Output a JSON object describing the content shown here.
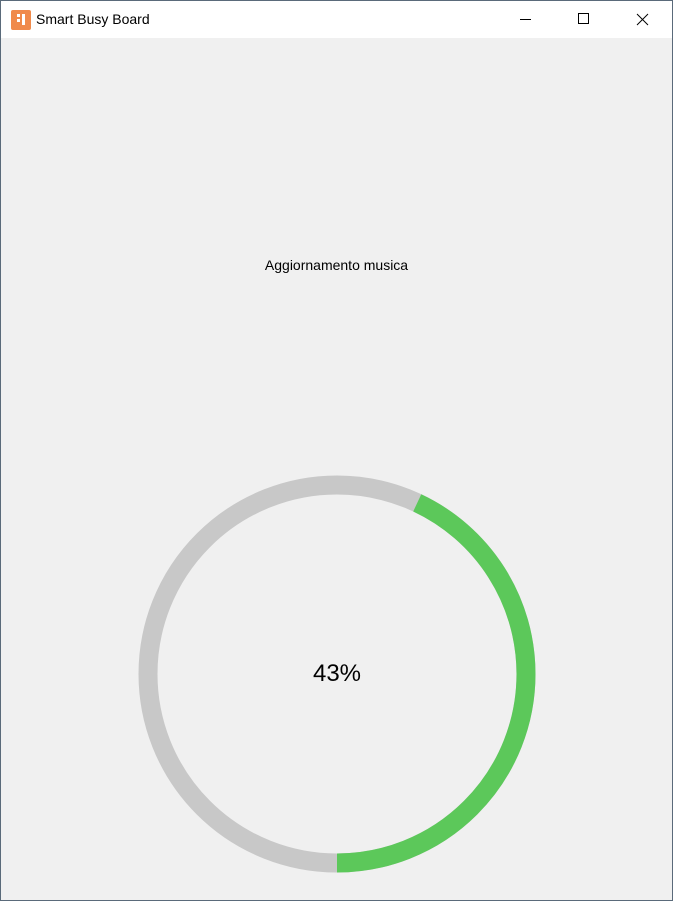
{
  "window": {
    "title": "Smart Busy Board",
    "icon": "app-icon",
    "controls": {
      "minimize_icon": "minimize-icon",
      "maximize_icon": "maximize-icon",
      "close_icon": "close-icon"
    }
  },
  "main": {
    "status_label": "Aggiornamento musica",
    "progress": {
      "value": 0.43,
      "percent_label": "43%",
      "fill_color": "#5cc85a",
      "track_color": "#c8c8c8"
    }
  }
}
